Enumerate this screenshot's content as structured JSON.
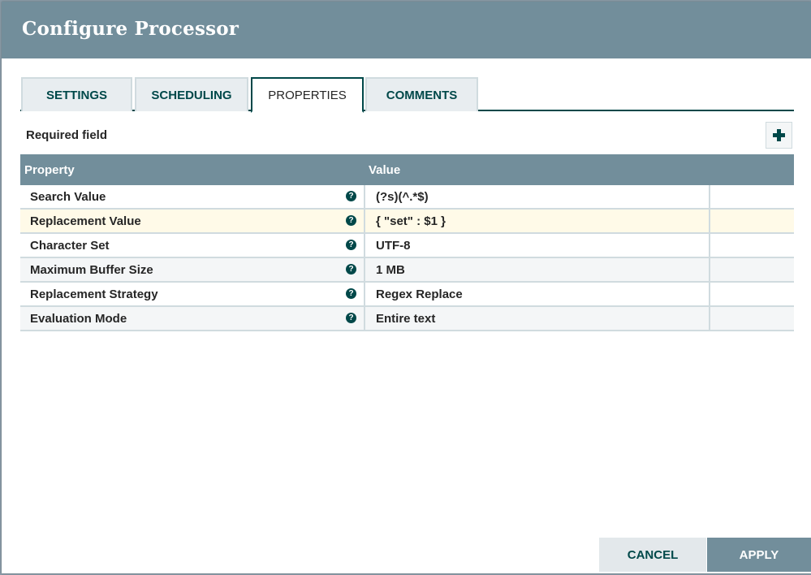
{
  "dialog": {
    "title": "Configure Processor"
  },
  "tabs": [
    {
      "label": "SETTINGS",
      "active": false
    },
    {
      "label": "SCHEDULING",
      "active": false
    },
    {
      "label": "PROPERTIES",
      "active": true
    },
    {
      "label": "COMMENTS",
      "active": false
    }
  ],
  "properties": {
    "required_field_label": "Required field",
    "add_button_icon": "plus-icon",
    "columns": {
      "property": "Property",
      "value": "Value"
    },
    "rows": [
      {
        "name": "Search Value",
        "value": "(?s)(^.*$)",
        "help_icon": "question-circle-icon"
      },
      {
        "name": "Replacement Value",
        "value": "{ \"set\" : $1 }",
        "help_icon": "question-circle-icon",
        "highlighted": true
      },
      {
        "name": "Character Set",
        "value": "UTF-8",
        "help_icon": "question-circle-icon"
      },
      {
        "name": "Maximum Buffer Size",
        "value": "1 MB",
        "help_icon": "question-circle-icon"
      },
      {
        "name": "Replacement Strategy",
        "value": "Regex Replace",
        "help_icon": "question-circle-icon"
      },
      {
        "name": "Evaluation Mode",
        "value": "Entire text",
        "help_icon": "question-circle-icon"
      }
    ],
    "help_glyph": "?"
  },
  "footer": {
    "cancel_label": "CANCEL",
    "apply_label": "APPLY"
  },
  "colors": {
    "header_bg": "#728e9b",
    "accent": "#004849",
    "highlight_row": "#fffae8"
  }
}
